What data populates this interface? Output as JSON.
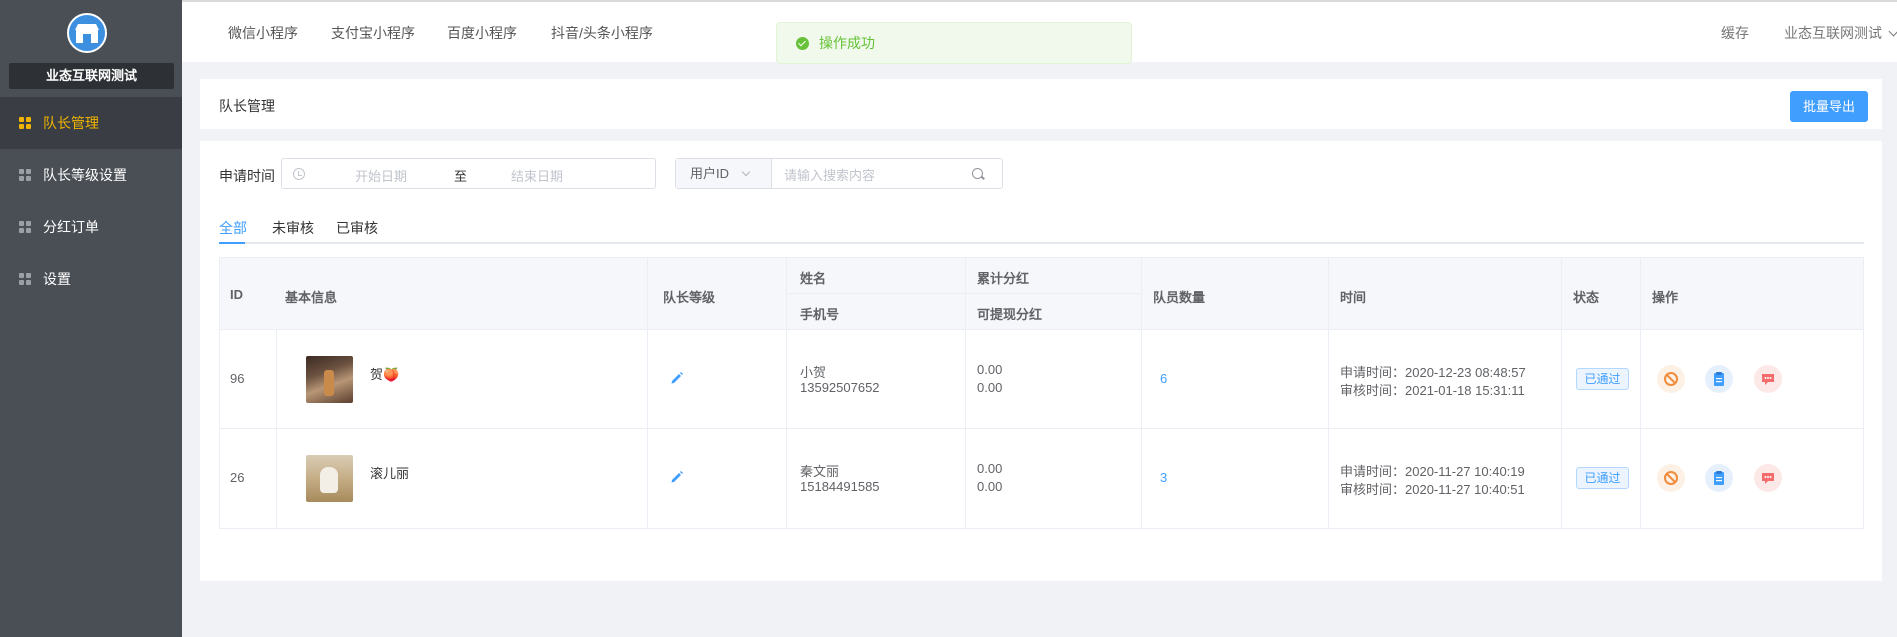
{
  "app": {
    "brand_name": "业态互联网测试"
  },
  "sidebar": {
    "items": [
      {
        "label": "队长管理",
        "active": true
      },
      {
        "label": "队长等级设置"
      },
      {
        "label": "分红订单"
      },
      {
        "label": "设置"
      }
    ]
  },
  "topbar": {
    "tabs": [
      "微信小程序",
      "支付宝小程序",
      "百度小程序",
      "抖音/头条小程序"
    ],
    "cache_label": "缓存",
    "account_label": "业态互联网测试"
  },
  "toast": {
    "message": "操作成功"
  },
  "page": {
    "title": "队长管理",
    "export_label": "批量导出"
  },
  "filter": {
    "date_label": "申请时间",
    "start_placeholder": "开始日期",
    "separator": "至",
    "end_placeholder": "结束日期",
    "search_field": "用户ID",
    "search_placeholder": "请输入搜索内容"
  },
  "tabs": [
    {
      "label": "全部",
      "active": true
    },
    {
      "label": "未审核"
    },
    {
      "label": "已审核"
    }
  ],
  "table": {
    "headers": {
      "id": "ID",
      "basic": "基本信息",
      "level": "队长等级",
      "name": "姓名",
      "phone": "手机号",
      "total_dividend": "累计分红",
      "withdrawable": "可提现分红",
      "members": "队员数量",
      "time": "时间",
      "status": "状态",
      "actions": "操作"
    },
    "rows": [
      {
        "id": "96",
        "nickname": "贺🍑",
        "name": "小贺",
        "phone": "13592507652",
        "total_dividend": "0.00",
        "withdrawable": "0.00",
        "members": "6",
        "apply_time": "申请时间：2020-12-23 08:48:57",
        "review_time": "审核时间：2021-01-18 15:31:11",
        "status": "已通过"
      },
      {
        "id": "26",
        "nickname": "滚儿丽",
        "name": "秦文丽",
        "phone": "15184491585",
        "total_dividend": "0.00",
        "withdrawable": "0.00",
        "members": "3",
        "apply_time": "申请时间：2020-11-27 10:40:19",
        "review_time": "审核时间：2020-11-27 10:40:51",
        "status": "已通过"
      }
    ]
  },
  "colors": {
    "primary": "#409eff",
    "sidebar": "#4a4f56",
    "active_nav": "#f0b400",
    "success": "#67c23a"
  }
}
